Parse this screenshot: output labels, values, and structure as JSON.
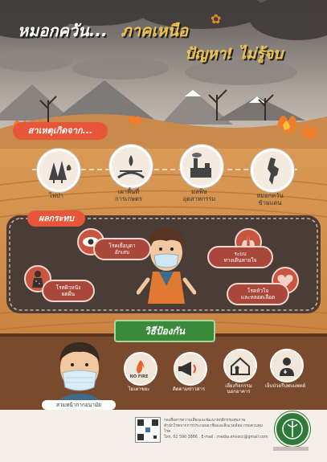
{
  "header": {
    "title_left": "หมอกควัน...",
    "title_right": "ภาคเหนือ",
    "subtitle": "ปัญหา! ไม่รู้จบ"
  },
  "causes": {
    "heading": "สาเหตุเกิดจาก...",
    "items": [
      {
        "label": "ไฟป่า",
        "icon": "forest-fire-icon"
      },
      {
        "label": "เผาพื้นที่\nการเกษตร",
        "icon": "farm-burning-icon"
      },
      {
        "label": "มลพิษ\nอุตสาหกรรม",
        "icon": "factory-icon"
      },
      {
        "label": "หมอกควัน\nข้ามแดน",
        "icon": "map-icon"
      }
    ]
  },
  "effects": {
    "heading": "ผลกระทบ",
    "items": [
      {
        "label": "โรคเยื่อบุตา\nอักเสบ",
        "icon": "eye-icon"
      },
      {
        "label": "ระบบ\nทางเดินหายใจ",
        "icon": "lungs-icon"
      },
      {
        "label": "โรคผิวหนัง\nผดผื่น",
        "icon": "skin-icon"
      },
      {
        "label": "โรคหัวใจ\nและหลอดเลือด",
        "icon": "heart-icon"
      }
    ]
  },
  "prevention": {
    "heading": "วิธีป้องกัน",
    "mask_label": "สวมหน้ากากอนามัย",
    "fire_badge": "NO FIRE",
    "items": [
      {
        "label": "ไม่เผาขยะ",
        "icon": "no-fire-icon"
      },
      {
        "label": "ติดตามข่าวสาร",
        "icon": "megaphone-icon"
      },
      {
        "label": "เลี่ยงกิจกรรม\nนอกอาคาร",
        "icon": "house-icon"
      },
      {
        "label": "เจ็บป่วยรีบพบแพทย์",
        "icon": "doctor-icon"
      }
    ]
  },
  "footer": {
    "line1": "กองสื่อสารความเสี่ยงและพัฒนาพฤติกรรมสุขภาพ",
    "line2": "สำนักโรคจากการประกอบอาชีพและสิ่งแวดล้อม กรมควบคุมโรค",
    "line3": "โทร. 02 590 3866 , E-mail : media.envocc@gmail.com"
  }
}
